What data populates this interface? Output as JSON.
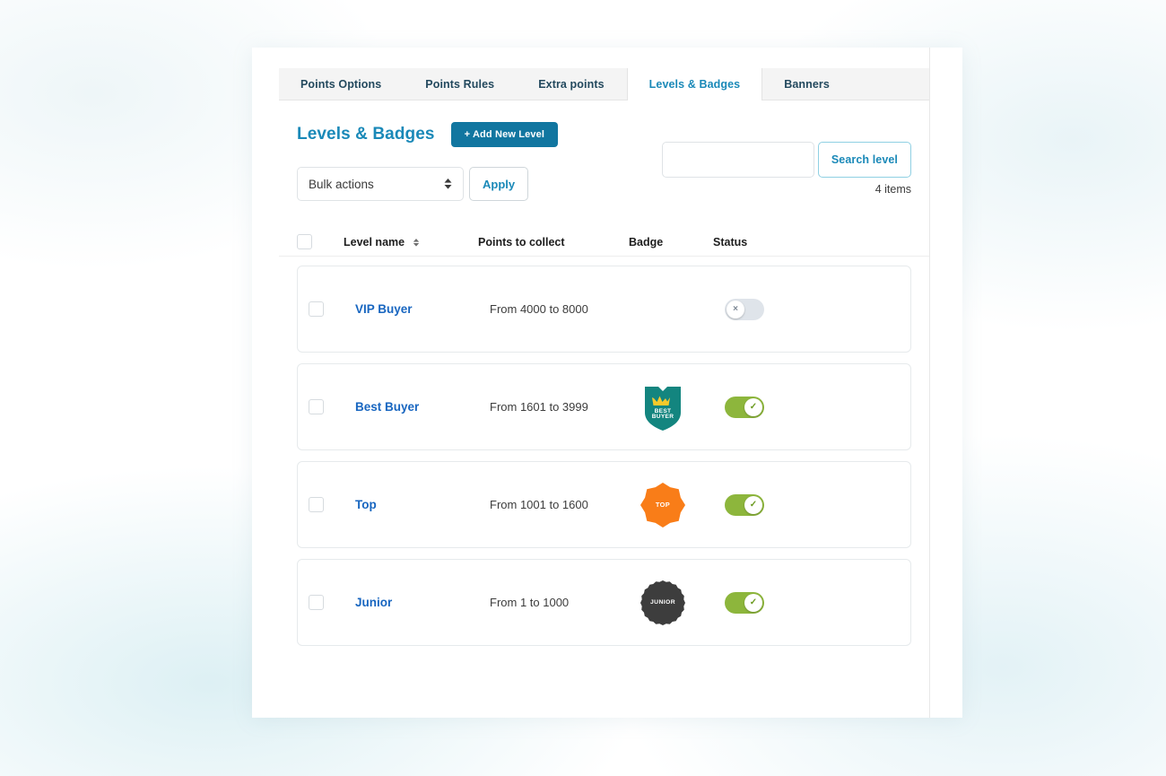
{
  "tabs": [
    {
      "label": "Points Options",
      "active": false
    },
    {
      "label": "Points Rules",
      "active": false
    },
    {
      "label": "Extra points",
      "active": false
    },
    {
      "label": "Levels & Badges",
      "active": true
    },
    {
      "label": "Banners",
      "active": false
    }
  ],
  "header": {
    "title": "Levels & Badges",
    "add_button": "+ Add New Level"
  },
  "search": {
    "value": "",
    "placeholder": "",
    "button": "Search level"
  },
  "items_count": "4 items",
  "bulk": {
    "selected": "Bulk actions",
    "apply": "Apply"
  },
  "table": {
    "columns": {
      "level_name": "Level name",
      "points": "Points to collect",
      "badge": "Badge",
      "status": "Status"
    },
    "rows": [
      {
        "name": "VIP Buyer",
        "points": "From 4000 to 8000",
        "badge": null,
        "badge_type": "none",
        "status_on": false,
        "status_glyph": "×"
      },
      {
        "name": "Best Buyer",
        "points": "From 1601 to 3999",
        "badge": "BEST BUYER",
        "badge_type": "shield-teal",
        "badge_color": "#13857f",
        "status_on": true,
        "status_glyph": "✓"
      },
      {
        "name": "Top",
        "points": "From 1001 to 1600",
        "badge": "TOP",
        "badge_type": "starburst-orange",
        "badge_color": "#f97d18",
        "status_on": true,
        "status_glyph": "✓"
      },
      {
        "name": "Junior",
        "points": "From 1 to 1000",
        "badge": "JUNIOR",
        "badge_type": "circle-dark",
        "badge_color": "#3d3d3d",
        "status_on": true,
        "status_glyph": "✓"
      }
    ]
  },
  "colors": {
    "accent": "#1a89b8",
    "button": "#1176a0",
    "link": "#1866c0",
    "toggle_on": "#8db63c",
    "toggle_off": "#dfe4ea"
  }
}
